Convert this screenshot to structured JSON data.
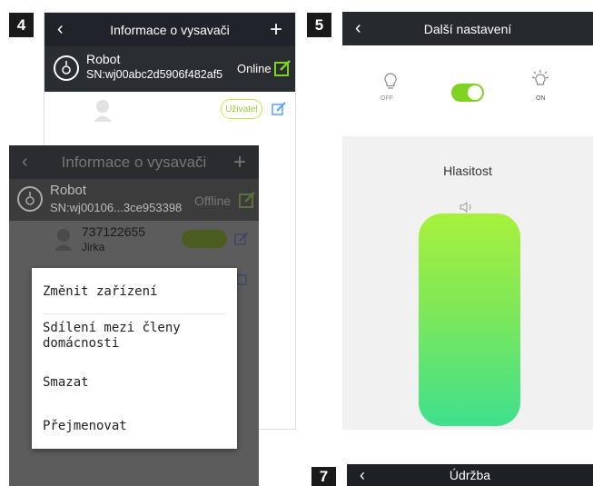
{
  "steps": {
    "s4": "4",
    "s5": "5",
    "s7": "7"
  },
  "panel4": {
    "title": "Informace o vysavači",
    "robot_name": "Robot",
    "robot_sn": "SN:wj00abc2d5906f482af5",
    "status": "Online",
    "user_role_badge": "Uživatel"
  },
  "panel4b": {
    "title": "Informace o vysavači",
    "robot_name": "Robot",
    "robot_sn": "SN:wj00106...3ce953398",
    "status": "Offline",
    "user_phone": "737122655",
    "user_name": "Jirka"
  },
  "context_menu": {
    "items": [
      "Změnit zařízení",
      "Sdílení mezi členy domácnosti",
      "Smazat",
      "Přejmenovat"
    ]
  },
  "panel5": {
    "title": "Další nastavení",
    "off_label": "OFF",
    "on_label": "ON",
    "volume_title": "Hlasitost",
    "volume_level": 1.0,
    "toggle_on": true
  },
  "panel7": {
    "title": "Údržba"
  },
  "colors": {
    "titlebar": "#262a2f",
    "accent_green": "#7ed321",
    "volume_top": "#a8f03c",
    "volume_bottom": "#3fe08e"
  }
}
